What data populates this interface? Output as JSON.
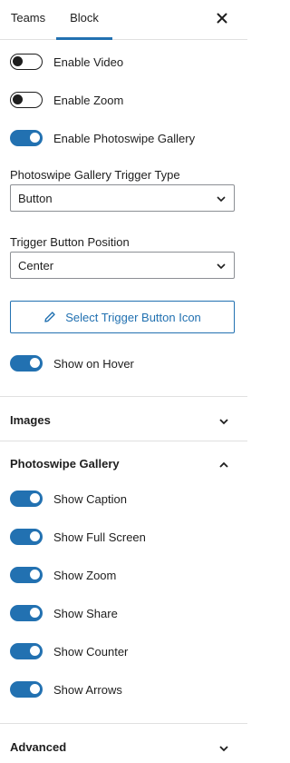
{
  "tabs": [
    {
      "label": "Teams",
      "active": false
    },
    {
      "label": "Block",
      "active": true
    }
  ],
  "close_icon": "close-icon",
  "settings": {
    "enable_video": {
      "label": "Enable Video",
      "on": false
    },
    "enable_zoom": {
      "label": "Enable Zoom",
      "on": false
    },
    "enable_photoswipe": {
      "label": "Enable Photoswipe Gallery",
      "on": true
    },
    "trigger_type": {
      "label": "Photoswipe Gallery Trigger Type",
      "value": "Button"
    },
    "trigger_position": {
      "label": "Trigger Button Position",
      "value": "Center"
    },
    "select_icon_button": {
      "label": "Select Trigger Button Icon",
      "icon": "pencil-icon"
    },
    "show_on_hover": {
      "label": "Show on Hover",
      "on": true
    }
  },
  "panels": {
    "images": {
      "title": "Images",
      "expanded": false
    },
    "photoswipe": {
      "title": "Photoswipe Gallery",
      "expanded": true,
      "toggles": [
        {
          "label": "Show Caption",
          "on": true
        },
        {
          "label": "Show Full Screen",
          "on": true
        },
        {
          "label": "Show Zoom",
          "on": true
        },
        {
          "label": "Show Share",
          "on": true
        },
        {
          "label": "Show Counter",
          "on": true
        },
        {
          "label": "Show Arrows",
          "on": true
        }
      ]
    },
    "advanced": {
      "title": "Advanced",
      "expanded": false
    }
  },
  "colors": {
    "accent": "#2271b1",
    "text": "#1e1e1e",
    "border": "#e0e0e0"
  }
}
